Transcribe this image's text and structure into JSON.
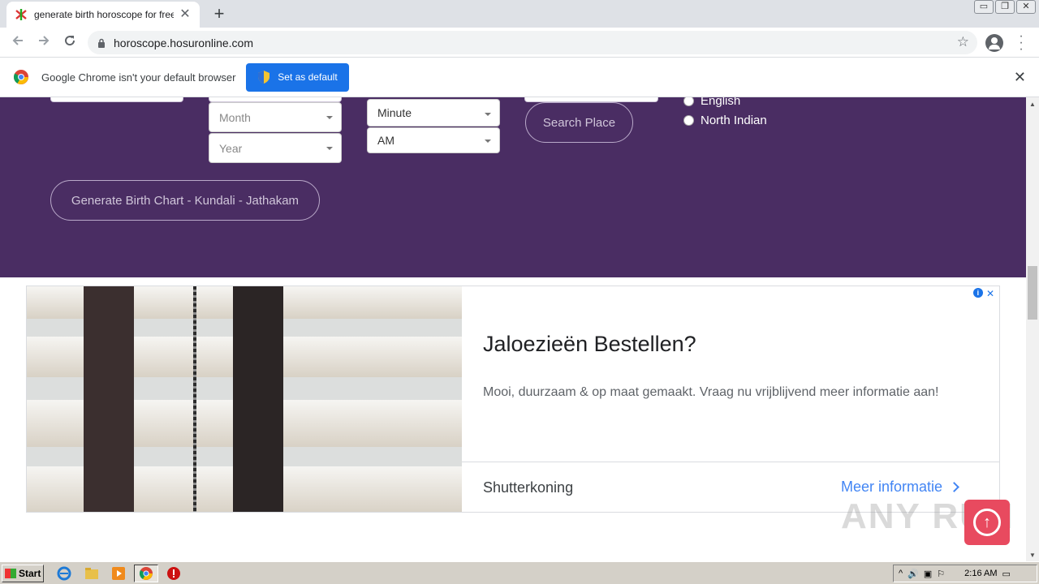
{
  "browser": {
    "tab_title": "generate birth horoscope for free, g",
    "tab_close": "✕",
    "new_tab": "+",
    "url": "horoscope.hosuronline.com",
    "window_controls": [
      "▭",
      "❐",
      "✕"
    ]
  },
  "infobar": {
    "message": "Google Chrome isn't your default browser",
    "button_label": "Set as default",
    "close": "✕"
  },
  "form": {
    "month_placeholder": "Month",
    "year_placeholder": "Year",
    "minute_value": "Minute",
    "ampm_value": "AM",
    "search_place_label": "Search Place",
    "generate_label": "Generate Birth Chart - Kundali - Jathakam",
    "chart_style_options": [
      "English",
      "North Indian"
    ]
  },
  "ad": {
    "title": "Jaloezieën Bestellen?",
    "description": "Mooi, duurzaam & op maat gemaakt. Vraag nu vrijblijvend meer informatie aan!",
    "advertiser": "Shutterkoning",
    "cta": "Meer informatie",
    "close": "✕",
    "info": "i"
  },
  "watermark": "ANY RUN",
  "taskbar": {
    "start_label": "Start",
    "clock": "2:16 AM"
  },
  "colors": {
    "hero_bg": "#4a2d63",
    "primary_button": "#1a73e8",
    "scroll_top": "#e84a5f",
    "ad_link": "#4285f4"
  }
}
